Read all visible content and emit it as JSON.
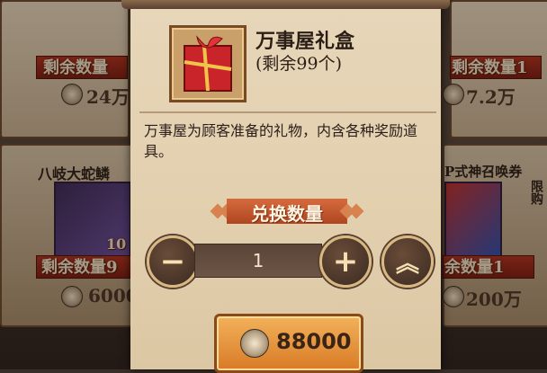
{
  "background": {
    "left_top": {
      "label": "剩余数量",
      "price": "24万"
    },
    "right_top": {
      "label": "剩余数量1",
      "price": "7.2万"
    },
    "left_item": {
      "name": "八岐大蛇鳞",
      "count": "10",
      "label": "剩余数量9",
      "price": "6000"
    },
    "right_item": {
      "name": "P式神召唤券",
      "tag": "限购",
      "label": "余数量1",
      "price": "200万"
    }
  },
  "modal": {
    "title": "万事屋礼盒",
    "remaining": "(剩余99个)",
    "description": "万事屋为顾客准备的礼物，内含各种奖励道具。",
    "exchange_label": "兑换数量",
    "quantity": "1",
    "minus_icon": "minus-icon",
    "plus_icon": "plus-icon",
    "max_icon": "double-chevron-up-icon",
    "price": "88000"
  },
  "colors": {
    "accent": "#d56b3c",
    "panel": "#e7d6b9",
    "button": "#f2b25a"
  }
}
